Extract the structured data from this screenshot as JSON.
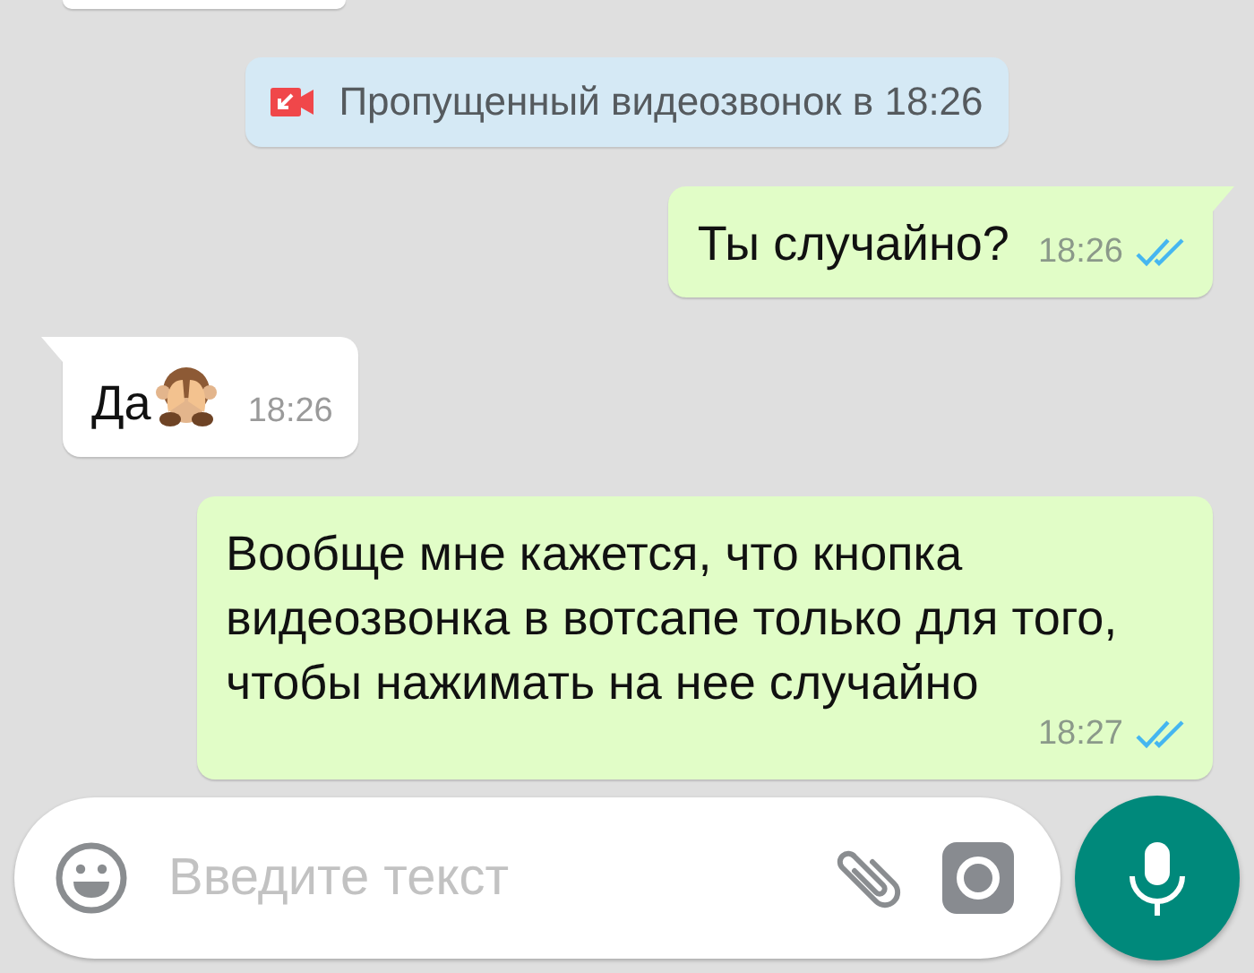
{
  "messages": [
    {
      "kind": "fragment"
    },
    {
      "kind": "system",
      "text": "Пропущенный видеозвонок в 18:26"
    },
    {
      "kind": "outgoing",
      "text": "Ты случайно?",
      "time": "18:26",
      "read": true,
      "tail": true
    },
    {
      "kind": "incoming",
      "text": "Да",
      "emoji_icon": true,
      "time": "18:26",
      "tail": true
    },
    {
      "kind": "outgoing",
      "text": "Вообще мне кажется, что кнопка видеозвонка в вотсапе только для того, чтобы нажимать на нее случайно",
      "time": "18:27",
      "read": true,
      "tail": false
    }
  ],
  "composer": {
    "placeholder": "Введите текст"
  }
}
